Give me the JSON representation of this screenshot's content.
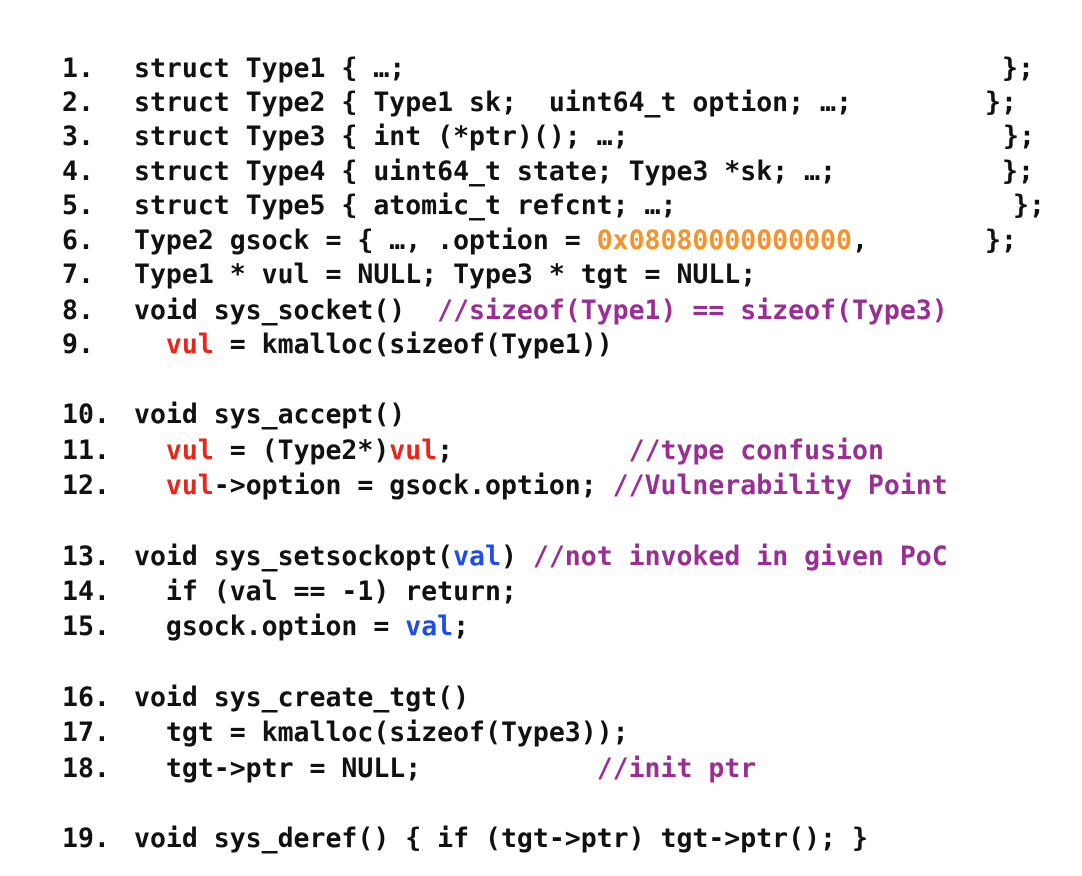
{
  "colors": {
    "text": "#111111",
    "variable_highlight": "#e8261b",
    "comment": "#9a2f93",
    "constant": "#f5922a",
    "parameter": "#1f4ee6"
  },
  "lines": [
    {
      "num": "1.",
      "segments": [
        {
          "t": "struct Type1 { …;"
        }
      ],
      "closer": "};"
    },
    {
      "num": "2.",
      "segments": [
        {
          "t": "struct Type2 { Type1 sk;  uint64_t option; …;"
        }
      ],
      "closer": "};"
    },
    {
      "num": "3.",
      "segments": [
        {
          "t": "struct Type3 { int (*ptr)(); …;"
        }
      ],
      "closer": "};"
    },
    {
      "num": "4.",
      "segments": [
        {
          "t": "struct Type4 { uint64_t state; Type3 *sk; …;"
        }
      ],
      "closer": "};"
    },
    {
      "num": "5.",
      "segments": [
        {
          "t": "struct Type5 { atomic_t refcnt; …;"
        }
      ],
      "closer": "};"
    },
    {
      "num": "6.",
      "segments": [
        {
          "t": "Type2 gsock = { …, .option = "
        },
        {
          "t": "0x08080000000000",
          "c": "constant"
        },
        {
          "t": ","
        }
      ],
      "closer": "};"
    },
    {
      "num": "7.",
      "segments": [
        {
          "t": "Type1 * vul = NULL; Type3 * tgt = NULL;"
        }
      ]
    },
    {
      "num": "8.",
      "segments": [
        {
          "t": "void sys_socket()  "
        },
        {
          "t": "//sizeof(Type1) == sizeof(Type3)",
          "c": "comment"
        }
      ]
    },
    {
      "num": "9.",
      "segments": [
        {
          "t": "  "
        },
        {
          "t": "vul",
          "c": "variable_highlight"
        },
        {
          "t": " = kmalloc(sizeof(Type1))"
        }
      ]
    },
    {
      "num": "10.",
      "segments": [
        {
          "t": "void sys_accept()"
        }
      ]
    },
    {
      "num": "11.",
      "segments": [
        {
          "t": "  "
        },
        {
          "t": "vul",
          "c": "variable_highlight"
        },
        {
          "t": " = (Type2*)"
        },
        {
          "t": "vul",
          "c": "variable_highlight"
        },
        {
          "t": ";           "
        },
        {
          "t": "//type confusion",
          "c": "comment"
        }
      ]
    },
    {
      "num": "12.",
      "segments": [
        {
          "t": "  "
        },
        {
          "t": "vul",
          "c": "variable_highlight"
        },
        {
          "t": "->option = gsock.option; "
        },
        {
          "t": "//Vulnerability Point",
          "c": "comment"
        }
      ]
    },
    {
      "num": "13.",
      "segments": [
        {
          "t": "void sys_setsockopt("
        },
        {
          "t": "val",
          "c": "parameter"
        },
        {
          "t": ") "
        },
        {
          "t": "//not invoked in given PoC",
          "c": "comment"
        }
      ]
    },
    {
      "num": "14.",
      "segments": [
        {
          "t": "  if (val == -1) return;"
        }
      ]
    },
    {
      "num": "15.",
      "segments": [
        {
          "t": "  gsock.option = "
        },
        {
          "t": "val",
          "c": "parameter"
        },
        {
          "t": ";"
        }
      ]
    },
    {
      "num": "16.",
      "segments": [
        {
          "t": "void sys_create_tgt()"
        }
      ]
    },
    {
      "num": "17.",
      "segments": [
        {
          "t": "  tgt = kmalloc(sizeof(Type3));"
        }
      ]
    },
    {
      "num": "18.",
      "segments": [
        {
          "t": "  tgt->ptr = NULL;           "
        },
        {
          "t": "//init ptr",
          "c": "comment"
        }
      ]
    },
    {
      "num": "19.",
      "segments": [
        {
          "t": "void sys_deref() { if (tgt->ptr) tgt->ptr(); }"
        }
      ]
    }
  ]
}
